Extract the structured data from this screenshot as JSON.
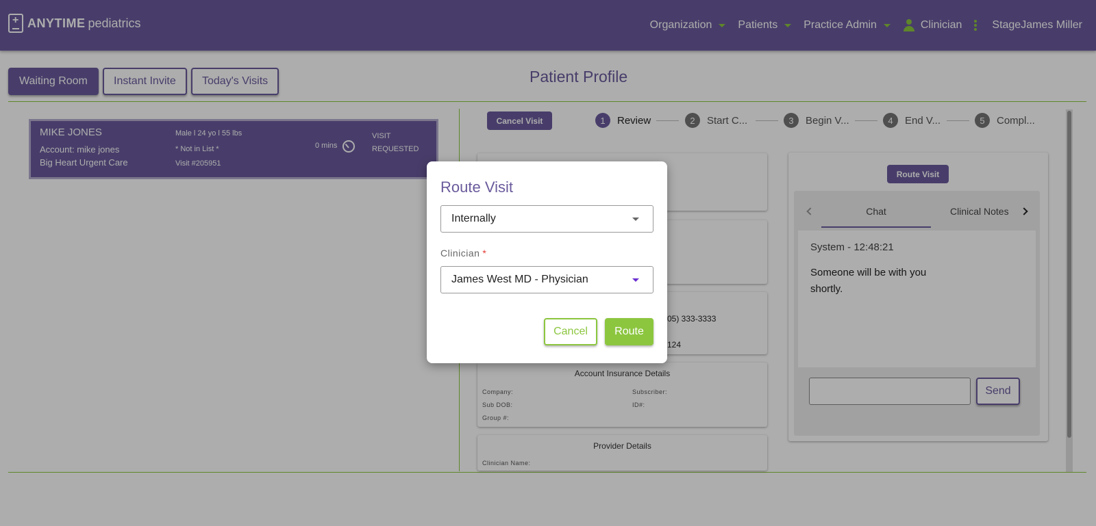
{
  "header": {
    "logo_bold": "ANYTIME",
    "logo_light": "pediatrics",
    "nav": {
      "organization": "Organization",
      "patients": "Patients",
      "practice_admin": "Practice Admin",
      "role": "Clinician",
      "user": "StageJames Miller"
    }
  },
  "page_tabs": {
    "waiting_room": "Waiting Room",
    "instant_invite": "Instant Invite",
    "todays_visits": "Today's Visits"
  },
  "page_title": "Patient Profile",
  "visit_card": {
    "name": "MIKE JONES",
    "account": "Account: mike jones",
    "organization": "Big Heart Urgent Care",
    "demographics": "Male l 24 yo l 55 lbs",
    "list_status": "* Not in List *",
    "visit_number": "Visit #205951",
    "wait_time": "0 mins",
    "status": "VISIT REQUESTED"
  },
  "visit_actions": {
    "cancel_visit": "Cancel Visit",
    "route_visit": "Route Visit"
  },
  "steps": [
    {
      "num": "1",
      "label": "Review"
    },
    {
      "num": "2",
      "label": "Start C..."
    },
    {
      "num": "3",
      "label": "Begin V..."
    },
    {
      "num": "4",
      "label": "End V..."
    },
    {
      "num": "5",
      "label": "Compl..."
    }
  ],
  "contact_card": {
    "phone_fragment": "05) 333-3333",
    "number_fragment": "124"
  },
  "insurance": {
    "title": "Account Insurance Details",
    "company_label": "Company:",
    "subscriber_label": "Subscriber:",
    "sub_dob_label": "Sub DOB:",
    "id_label": "ID#:",
    "group_label": "Group #:"
  },
  "provider": {
    "title": "Provider Details",
    "clinician_label": "Clinician Name:"
  },
  "chat": {
    "tab_chat": "Chat",
    "tab_notes": "Clinical Notes",
    "message_header": "System - 12:48:21",
    "message_body": "Someone will be with you shortly.",
    "input_value": "",
    "send_label": "Send"
  },
  "route_dialog": {
    "title": "Route Visit",
    "route_type": "Internally",
    "clinician_label": "Clinician",
    "required_mark": "*",
    "clinician_value": "James West MD - Physician",
    "cancel_label": "Cancel",
    "route_label": "Route"
  },
  "colors": {
    "brand_purple": "#6a5a9c",
    "accent_green": "#8cc63f"
  }
}
